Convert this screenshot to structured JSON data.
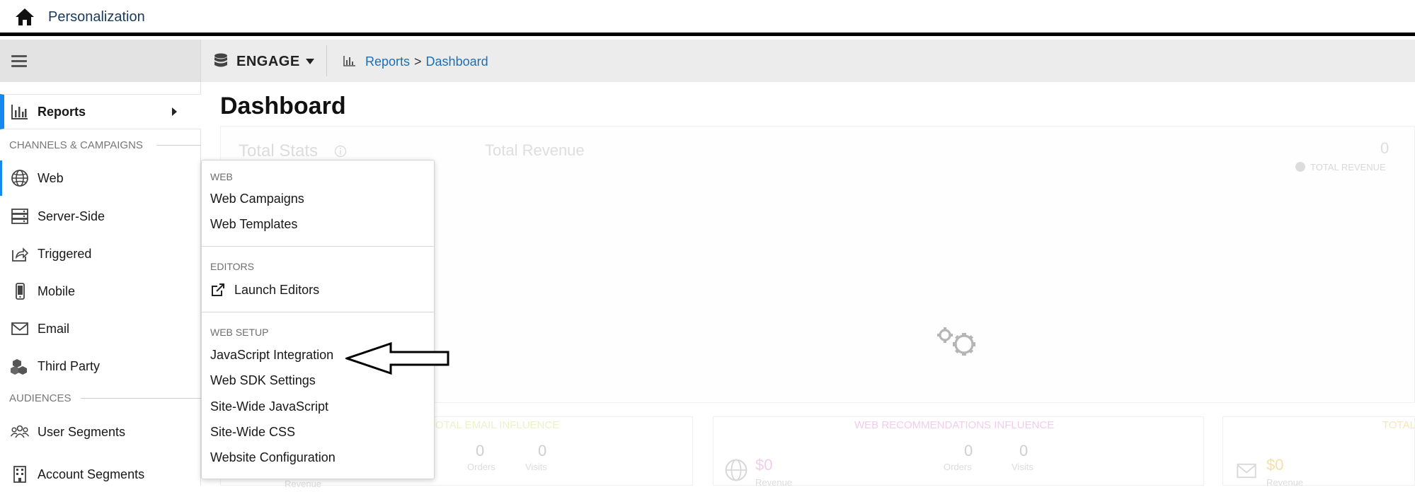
{
  "header": {
    "app_title": "Personalization"
  },
  "toolbar": {
    "dataset": "ENGAGE",
    "breadcrumb": [
      "Reports",
      "Dashboard"
    ],
    "breadcrumb_sep": ">"
  },
  "sidebar": {
    "reports_label": "Reports",
    "section_channels": "CHANNELS & CAMPAIGNS",
    "section_audiences": "AUDIENCES",
    "items": [
      {
        "label": "Web",
        "icon": "globe-icon"
      },
      {
        "label": "Server-Side",
        "icon": "server-icon"
      },
      {
        "label": "Triggered",
        "icon": "share-icon"
      },
      {
        "label": "Mobile",
        "icon": "mobile-icon"
      },
      {
        "label": "Email",
        "icon": "envelope-icon"
      },
      {
        "label": "Third Party",
        "icon": "boxes-icon"
      }
    ],
    "audience_items": [
      {
        "label": "User Segments",
        "icon": "users-icon"
      },
      {
        "label": "Account Segments",
        "icon": "building-icon"
      }
    ]
  },
  "main": {
    "page_title": "Dashboard",
    "total_stats": "Total Stats",
    "total_revenue_title": "Total Revenue",
    "total_revenue_value": "0",
    "total_revenue_legend": "TOTAL REVENUE",
    "email_influence": "TOTAL EMAIL INFLUENCE",
    "email_orders_value": "0",
    "email_visits_value": "0",
    "web_rec_influence": "WEB RECOMMENDATIONS INFLUENCE",
    "web_rec_revenue": "$0",
    "web_rec_orders_value": "0",
    "web_rec_visits_value": "0",
    "right_card_label": "TOTAL",
    "right_card_revenue": "$0",
    "orders_label": "Orders",
    "visits_label": "Visits",
    "revenue_label": "Revenue"
  },
  "dropdown": {
    "sections": [
      {
        "heading": "WEB",
        "items": [
          "Web Campaigns",
          "Web Templates"
        ]
      },
      {
        "heading": "EDITORS",
        "items": [
          "Launch Editors"
        ]
      },
      {
        "heading": "WEB SETUP",
        "items": [
          "JavaScript Integration",
          "Web SDK Settings",
          "Site-Wide JavaScript",
          "Site-Wide CSS",
          "Website Configuration"
        ]
      }
    ]
  },
  "colors": {
    "accent": "#1589ee",
    "link": "#1a6fb5",
    "title": "#1b3a5b"
  }
}
